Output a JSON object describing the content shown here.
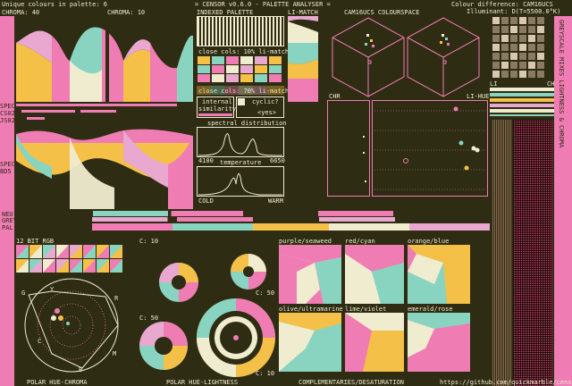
{
  "header": {
    "unique_colours": "Unique colours in palette: 6",
    "title": "= CENSOR v0.6.0 - PALETTE ANALYSER =",
    "colour_difference": "Colour difference: CAM16UCS",
    "illuminant": "Illuminant: D(T=5500.0°K)"
  },
  "labels": {
    "chroma_40": "CHROMA: 40",
    "chroma_10": "CHROMA: 10",
    "indexed_palette": "INDEXED PALETTE",
    "li_match": "LI-MATCH",
    "cam16ucs": "CAM16UCS COLOURSPACE",
    "spec": "SPEC",
    "cs02": "CS02",
    "js02": "JS02",
    "spec_bd5": [
      "SPEC",
      "BD5"
    ],
    "close_cols_10": "close cols: 10% li-match",
    "close_cols_70": "close cols: 70% li-match",
    "internal_similarity": [
      "internal",
      "similarity"
    ],
    "cyclic": "cyclic?",
    "yes": "<yes>",
    "spectral_distribution": "spectral distribution",
    "spec_min": "4100",
    "spec_max": "6650",
    "temperature": "temperature",
    "cold": "COLD",
    "warm": "WARM",
    "chr": "CHR",
    "li_hue": "LI-HUE",
    "li": "LI",
    "chr2": "CHR",
    "neu_grey": [
      "NEU",
      "GREY"
    ],
    "pal": "PAL",
    "bit12": "12 BIT RGB",
    "c10a": "C: 10",
    "c50a": "C: 50",
    "c50b": "C: 50",
    "c10b": "C: 10",
    "purple_seaweed": "purple/seaweed",
    "red_cyan": "red/cyan",
    "orange_blue": "orange/blue",
    "olive_ultramarine": "olive/ultramarine",
    "lime_violet": "lime/violet",
    "emerald_rose": "emerald/rose",
    "polar_hue_chroma": "POLAR HUE-CHROMA",
    "polar_hue_lightness": "POLAR HUE-LIGHTNESS",
    "complementaries": "COMPLEMENTARIES/DESATURATION",
    "github": "https://github.com/quickmarble/censor",
    "side_vertical": "GREYSCALE MIXES  LIGHTNESS & CHROMA",
    "hc_letters": [
      "G",
      "Y",
      "R",
      "C",
      "B",
      "M"
    ]
  },
  "palette": {
    "colors": [
      "#2e2c12",
      "#f07cb4",
      "#f0ecd0",
      "#88d4c0",
      "#f4c048",
      "#e8a8d0"
    ],
    "names": [
      "dark",
      "pink",
      "cream",
      "cyan",
      "yellow",
      "lightpink"
    ]
  }
}
